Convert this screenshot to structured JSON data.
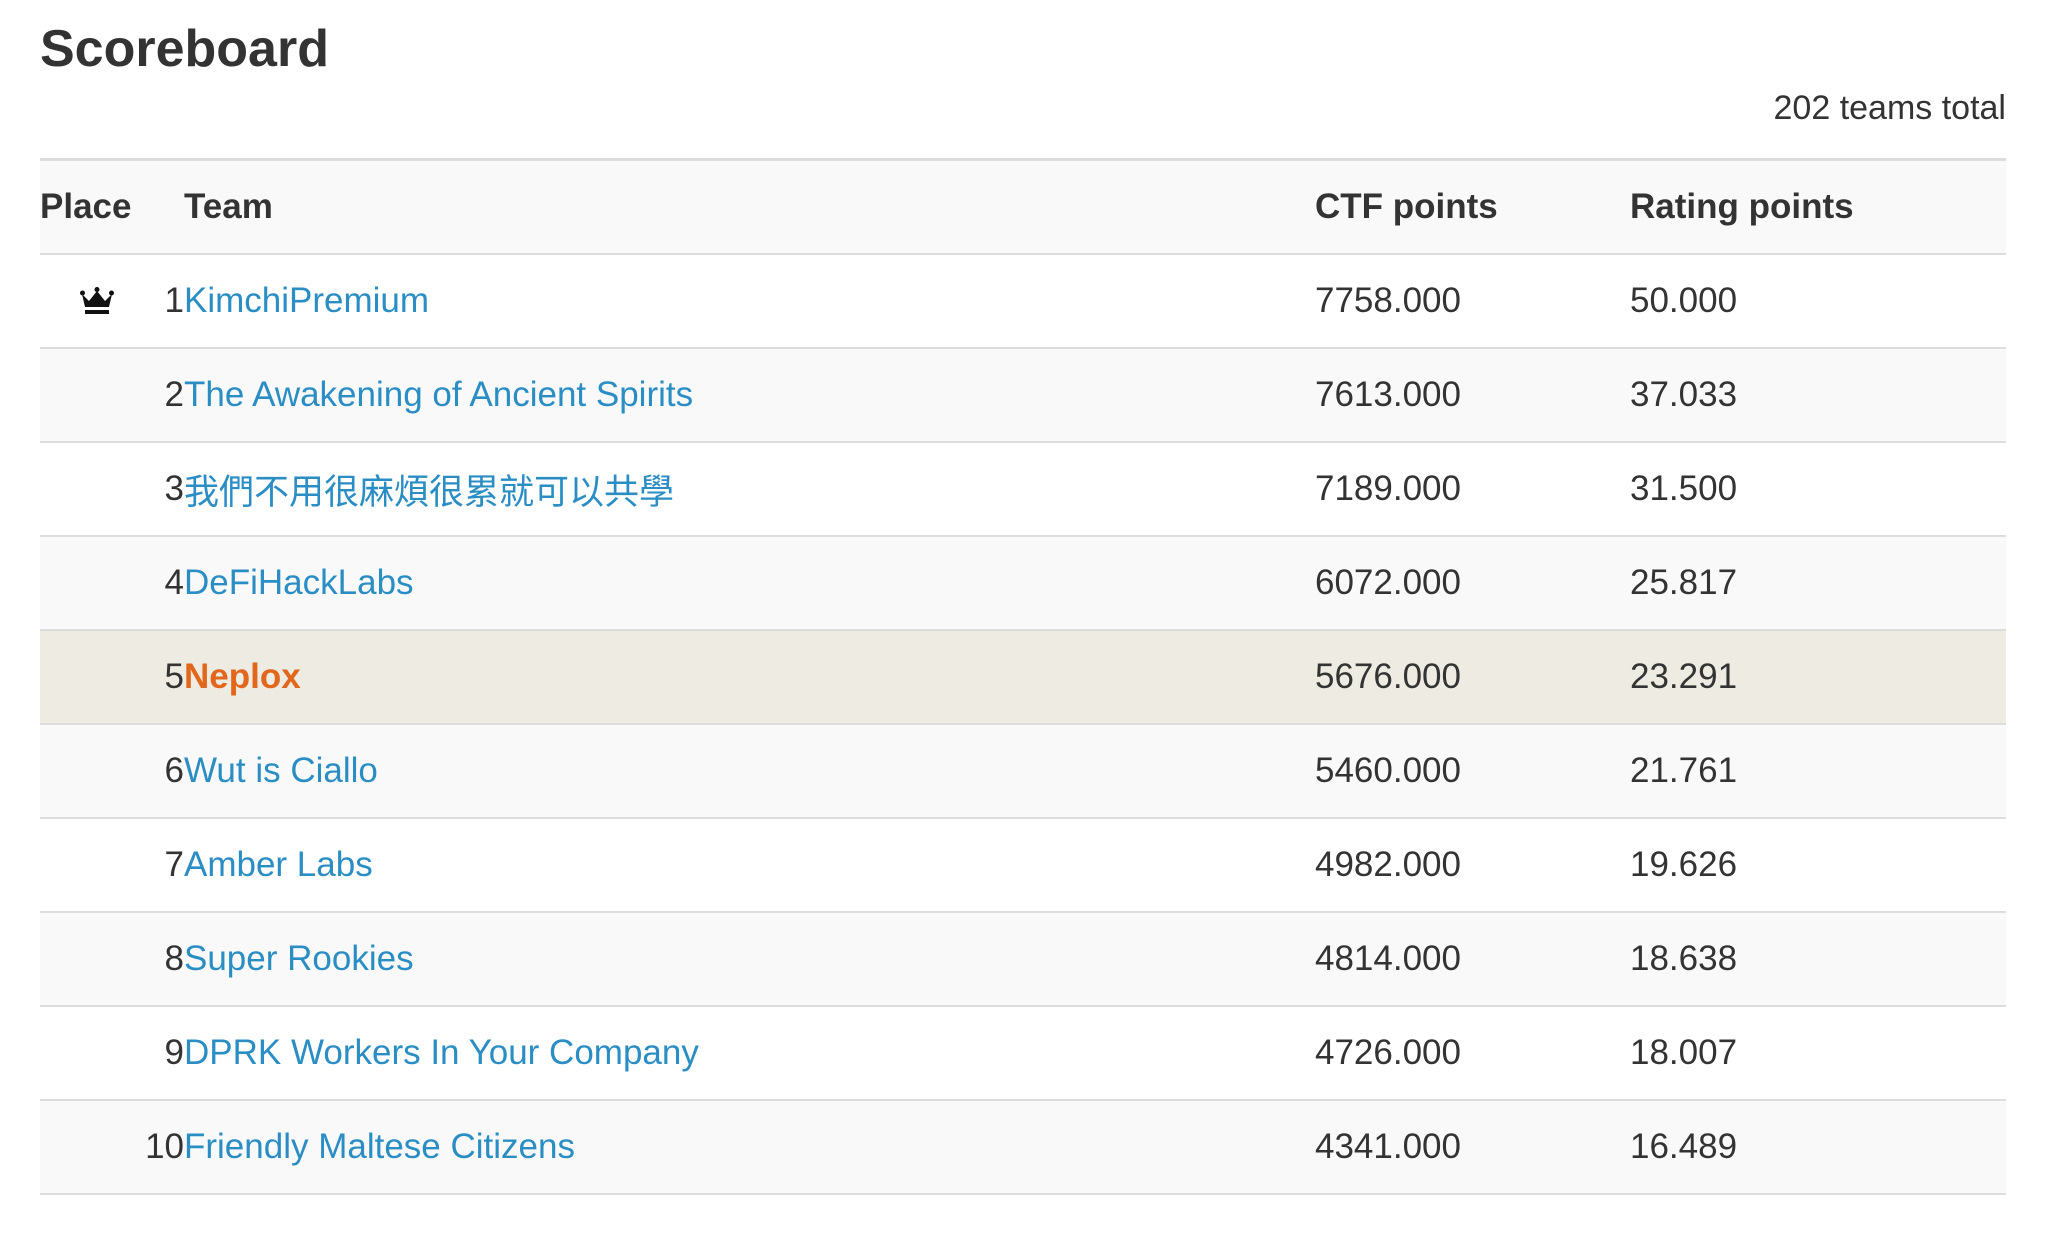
{
  "page": {
    "title": "Scoreboard",
    "teams_total": "202 teams total"
  },
  "table": {
    "headers": {
      "place": "Place",
      "team": "Team",
      "ctf_points": "CTF points",
      "rating_points": "Rating points"
    },
    "rows": [
      {
        "place": "1",
        "team": "KimchiPremium",
        "ctf": "7758.000",
        "rating": "50.000",
        "icon": "crown-icon"
      },
      {
        "place": "2",
        "team": "The Awakening of Ancient Spirits",
        "ctf": "7613.000",
        "rating": "37.033"
      },
      {
        "place": "3",
        "team": "我們不用很麻煩很累就可以共學",
        "ctf": "7189.000",
        "rating": "31.500"
      },
      {
        "place": "4",
        "team": "DeFiHackLabs",
        "ctf": "6072.000",
        "rating": "25.817"
      },
      {
        "place": "5",
        "team": "Neplox",
        "ctf": "5676.000",
        "rating": "23.291",
        "highlighted": true
      },
      {
        "place": "6",
        "team": "Wut is Ciallo",
        "ctf": "5460.000",
        "rating": "21.761"
      },
      {
        "place": "7",
        "team": "Amber Labs",
        "ctf": "4982.000",
        "rating": "19.626"
      },
      {
        "place": "8",
        "team": "Super Rookies",
        "ctf": "4814.000",
        "rating": "18.638"
      },
      {
        "place": "9",
        "team": "DPRK Workers In Your Company",
        "ctf": "4726.000",
        "rating": "18.007"
      },
      {
        "place": "10",
        "team": "Friendly Maltese Citizens",
        "ctf": "4341.000",
        "rating": "16.489"
      }
    ]
  },
  "colors": {
    "link": "#2a8dc4",
    "highlight_link": "#e2661b",
    "highlight_row": "#edebe2",
    "stripe_row": "#f9f9f9",
    "text": "#333333"
  }
}
